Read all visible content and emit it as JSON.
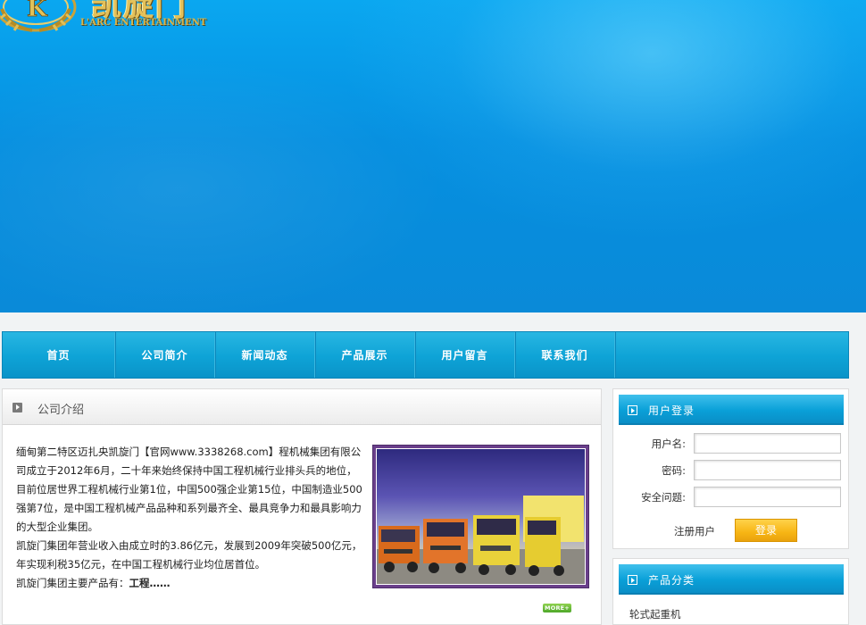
{
  "brand": {
    "name_cn": "凯旋门",
    "name_en": "L'ARC ENTERTAINMENT"
  },
  "nav": {
    "items": [
      {
        "label": "首页"
      },
      {
        "label": "公司简介"
      },
      {
        "label": "新闻动态"
      },
      {
        "label": "产品展示"
      },
      {
        "label": "用户留言"
      },
      {
        "label": "联系我们"
      }
    ]
  },
  "intro_panel": {
    "title": "公司介绍",
    "paragraphs": [
      "缅甸第二特区迈扎央凯旋门【官网www.3338268.com】程机械集团有限公司成立于2012年6月，二十年来始终保持中国工程机械行业排头兵的地位，目前位居世界工程机械行业第1位，中国500强企业第15位，中国制造业500强第7位，是中国工程机械产品品种和系列最齐全、最具竞争力和最具影响力的大型企业集团。",
      "凯旋门集团年营业收入由成立时的3.86亿元，发展到2009年突破500亿元，年实现利税35亿元，在中国工程机械行业均位居首位。"
    ],
    "products_prefix": "凯旋门集团主要产品有：",
    "products_bold": "工程……",
    "more_label": "MORE+"
  },
  "login": {
    "title": "用户登录",
    "username_label": "用户名:",
    "password_label": "密码:",
    "question_label": "安全问题:",
    "register_label": "注册用户",
    "submit_label": "登录"
  },
  "category": {
    "title": "产品分类",
    "items": [
      "轮式起重机"
    ]
  }
}
